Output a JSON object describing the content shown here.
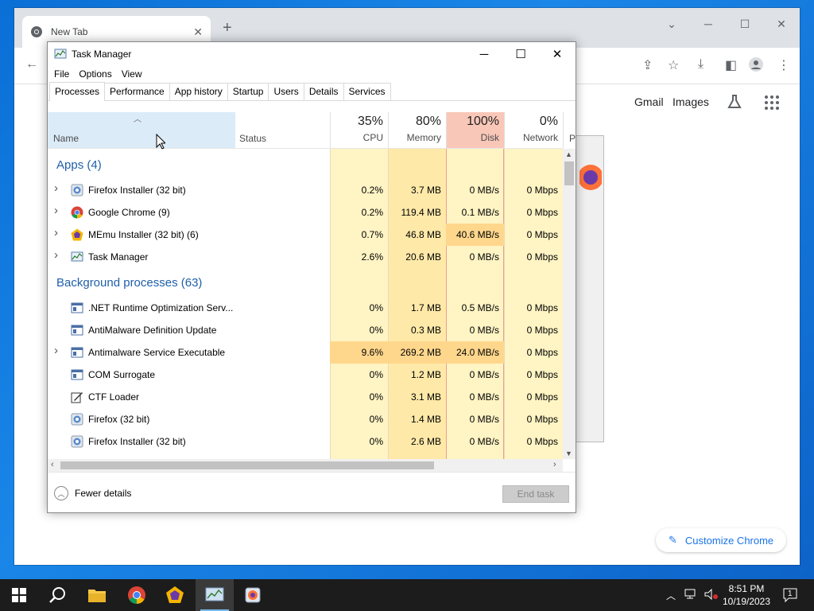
{
  "chrome": {
    "tab_title": "New Tab",
    "links": [
      "Gmail",
      "Images"
    ],
    "customize_label": "Customize Chrome"
  },
  "task_manager": {
    "title": "Task Manager",
    "menu": [
      "File",
      "Options",
      "View"
    ],
    "tabs": [
      "Processes",
      "Performance",
      "App history",
      "Startup",
      "Users",
      "Details",
      "Services"
    ],
    "active_tab": "Processes",
    "columns": {
      "name": "Name",
      "status": "Status",
      "cpu": {
        "pct": "35%",
        "label": "CPU"
      },
      "memory": {
        "pct": "80%",
        "label": "Memory"
      },
      "disk": {
        "pct": "100%",
        "label": "Disk"
      },
      "network": {
        "pct": "0%",
        "label": "Network"
      },
      "power_cut": "P"
    },
    "groups": {
      "apps": "Apps (4)",
      "background": "Background processes (63)"
    },
    "apps": [
      {
        "name": "Firefox Installer (32 bit)",
        "icon": "firefox-installer-icon",
        "expandable": true,
        "cpu": "0.2%",
        "mem": "3.7 MB",
        "disk": "0 MB/s",
        "net": "0 Mbps"
      },
      {
        "name": "Google Chrome (9)",
        "icon": "chrome-icon",
        "expandable": true,
        "cpu": "0.2%",
        "mem": "119.4 MB",
        "disk": "0.1 MB/s",
        "net": "0 Mbps"
      },
      {
        "name": "MEmu Installer (32 bit) (6)",
        "icon": "memu-icon",
        "expandable": true,
        "cpu": "0.7%",
        "mem": "46.8 MB",
        "disk": "40.6 MB/s",
        "disk_hot": true,
        "net": "0 Mbps"
      },
      {
        "name": "Task Manager",
        "icon": "task-manager-icon",
        "expandable": true,
        "cpu": "2.6%",
        "mem": "20.6 MB",
        "disk": "0 MB/s",
        "net": "0 Mbps"
      }
    ],
    "background": [
      {
        "name": ".NET Runtime Optimization Serv...",
        "icon": "service-icon",
        "expandable": false,
        "cpu": "0%",
        "mem": "1.7 MB",
        "disk": "0.5 MB/s",
        "net": "0 Mbps"
      },
      {
        "name": "AntiMalware Definition Update",
        "icon": "service-icon",
        "expandable": false,
        "cpu": "0%",
        "mem": "0.3 MB",
        "disk": "0 MB/s",
        "net": "0 Mbps"
      },
      {
        "name": "Antimalware Service Executable",
        "icon": "service-icon",
        "expandable": true,
        "cpu": "9.6%",
        "cpu_hot": true,
        "mem": "269.2 MB",
        "mem_hot": true,
        "disk": "24.0 MB/s",
        "disk_hot": true,
        "net": "0 Mbps"
      },
      {
        "name": "COM Surrogate",
        "icon": "service-icon",
        "expandable": false,
        "cpu": "0%",
        "mem": "1.2 MB",
        "disk": "0 MB/s",
        "net": "0 Mbps"
      },
      {
        "name": "CTF Loader",
        "icon": "ctf-loader-icon",
        "expandable": false,
        "cpu": "0%",
        "mem": "3.1 MB",
        "disk": "0 MB/s",
        "net": "0 Mbps"
      },
      {
        "name": "Firefox (32 bit)",
        "icon": "firefox-installer-icon",
        "expandable": false,
        "cpu": "0%",
        "mem": "1.4 MB",
        "disk": "0 MB/s",
        "net": "0 Mbps"
      },
      {
        "name": "Firefox Installer (32 bit)",
        "icon": "firefox-installer-icon",
        "expandable": false,
        "cpu": "0%",
        "mem": "2.6 MB",
        "disk": "0 MB/s",
        "net": "0 Mbps"
      }
    ],
    "fewer_details": "Fewer details",
    "end_task": "End task"
  },
  "taskbar": {
    "time": "8:51 PM",
    "date": "10/19/2023",
    "notification_count": "1",
    "apps": [
      "start-icon",
      "search-icon",
      "file-explorer-icon",
      "chrome-icon",
      "memu-icon",
      "task-manager-icon",
      "firefox-installer-icon"
    ]
  },
  "colors": {
    "heat_light": "#fff4c4",
    "heat_mid": "#ffe9a8",
    "heat_hot": "#ffd78c",
    "disk_header": "#f9c7b8",
    "group_label": "#1f5fa8",
    "desktop_blue": "#0a6fd6"
  }
}
